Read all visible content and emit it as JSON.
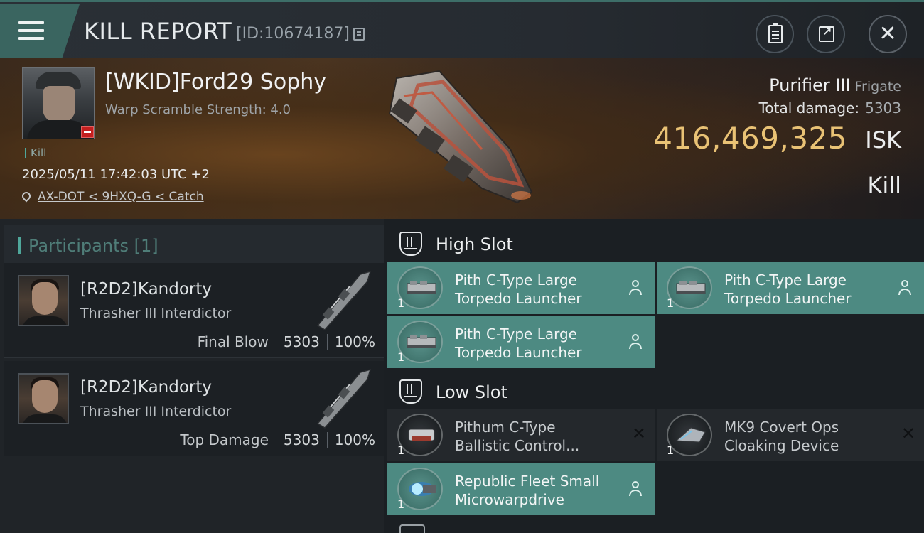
{
  "header": {
    "title": "KILL REPORT",
    "report_id": "[ID:10674187]",
    "menu_icon": "hamburger-icon",
    "buttons": [
      "clipboard-icon",
      "share-icon",
      "close-icon"
    ]
  },
  "victim": {
    "name": "[WKID]Ford29 Sophy",
    "warp_scramble": "Warp Scramble Strength: 4.0",
    "tag": "Kill",
    "timestamp": "2025/05/11 17:42:03 UTC +2",
    "location": "AX-DOT < 9HXQ-G < Catch",
    "ship_name": "Purifier III",
    "ship_class": "Frigate",
    "total_damage_label": "Total damage:",
    "total_damage_value": "5303",
    "isk_value": "416,469,325",
    "isk_label": "ISK",
    "result": "Kill"
  },
  "participants": {
    "title": "Participants",
    "count": "[1]",
    "items": [
      {
        "name": "[R2D2]Kandorty",
        "ship": "Thrasher III Interdictor",
        "role": "Final Blow",
        "damage": "5303",
        "percent": "100%"
      },
      {
        "name": "[R2D2]Kandorty",
        "ship": "Thrasher III Interdictor",
        "role": "Top Damage",
        "damage": "5303",
        "percent": "100%"
      }
    ]
  },
  "fitting": {
    "high_slot": {
      "title": "High Slot",
      "modules": [
        {
          "line1": "Pith C-Type Large",
          "line2": "Torpedo Launcher",
          "qty": "1",
          "state": "dropped"
        },
        {
          "line1": "Pith C-Type Large",
          "line2": "Torpedo Launcher",
          "qty": "1",
          "state": "dropped"
        },
        {
          "line1": "Pith C-Type Large",
          "line2": "Torpedo Launcher",
          "qty": "1",
          "state": "dropped"
        }
      ]
    },
    "low_slot": {
      "title": "Low Slot",
      "modules": [
        {
          "line1": "Pithum C-Type",
          "line2": "Ballistic Control...",
          "qty": "1",
          "state": "destroyed"
        },
        {
          "line1": "MK9 Covert Ops",
          "line2": "Cloaking Device",
          "qty": "1",
          "state": "destroyed"
        },
        {
          "line1": "Republic Fleet Small",
          "line2": "Microwarpdrive",
          "qty": "1",
          "state": "dropped"
        }
      ]
    }
  },
  "colors": {
    "accent_teal": "#4d8a82",
    "isk_gold": "#e9c275",
    "destroyed_red": "#c41f1f"
  }
}
